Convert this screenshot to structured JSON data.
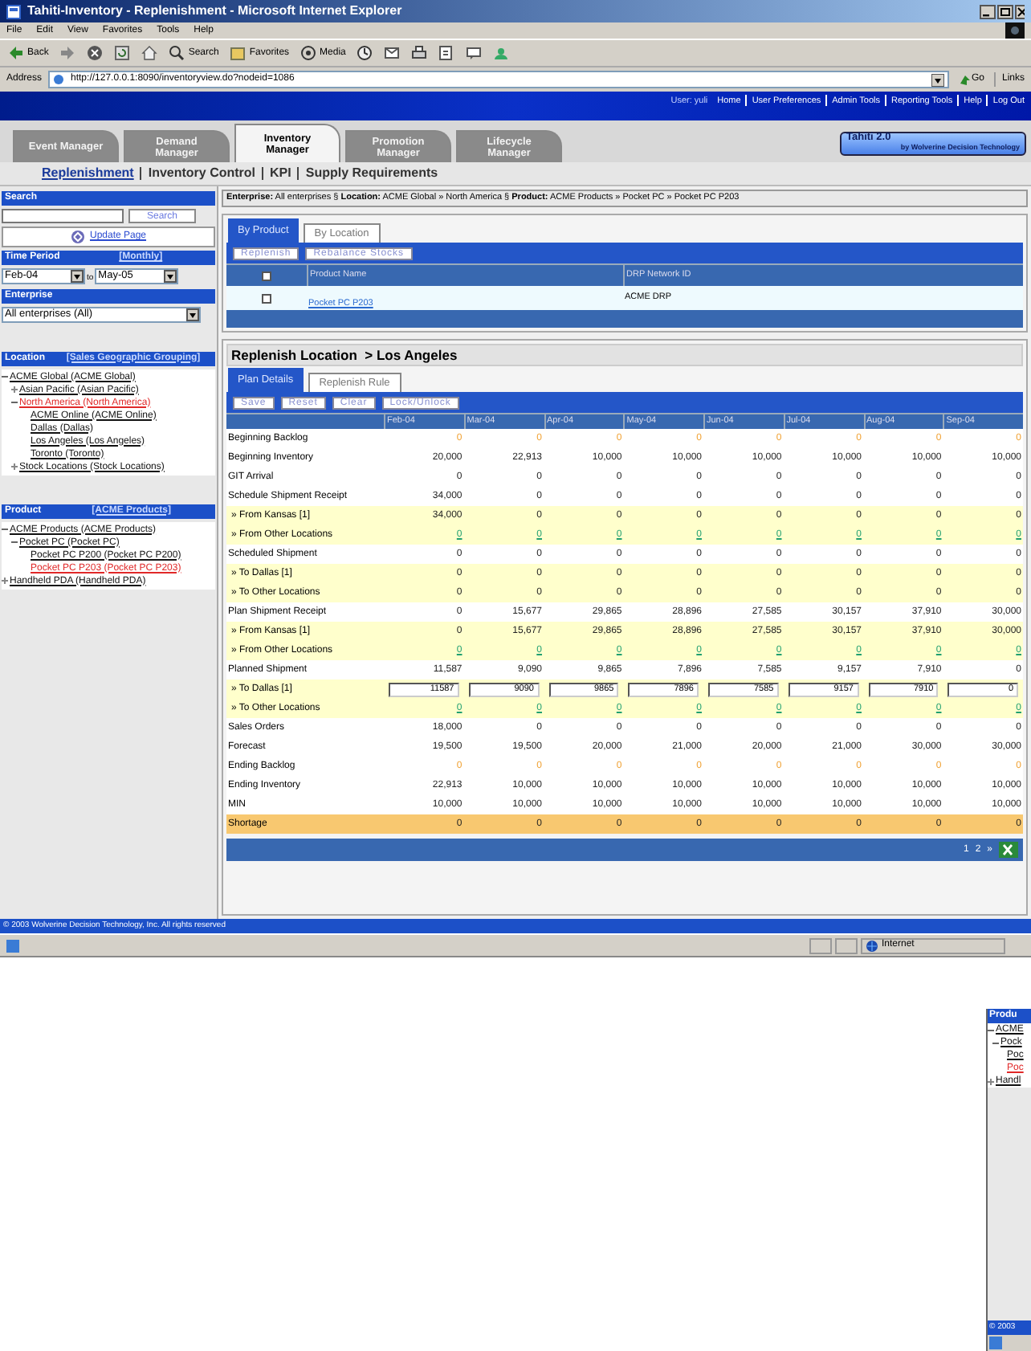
{
  "window": {
    "title": "Tahiti-Inventory - Replenishment - Microsoft Internet Explorer"
  },
  "menu": [
    "File",
    "Edit",
    "View",
    "Favorites",
    "Tools",
    "Help"
  ],
  "toolbar": [
    {
      "kind": "back",
      "label": "Back"
    },
    {
      "kind": "forward"
    },
    {
      "kind": "stop"
    },
    {
      "kind": "refresh"
    },
    {
      "kind": "home"
    },
    {
      "kind": "search",
      "label": "Search"
    },
    {
      "kind": "favorites",
      "label": "Favorites"
    },
    {
      "kind": "media",
      "label": "Media"
    },
    {
      "kind": "history"
    },
    {
      "kind": "mail"
    },
    {
      "kind": "print"
    },
    {
      "kind": "edit"
    },
    {
      "kind": "discuss"
    },
    {
      "kind": "messenger"
    }
  ],
  "address": {
    "label": "Address",
    "url": "http://127.0.0.1:8090/inventoryview.do?nodeid=1086",
    "go": "Go",
    "links": "Links"
  },
  "header": {
    "user": "User: yuli",
    "links": [
      "Home",
      "User Preferences",
      "Admin Tools",
      "Reporting Tools",
      "Help",
      "Log Out"
    ]
  },
  "modules": [
    {
      "label": "Event Manager",
      "selected": false
    },
    {
      "label": "Demand Manager",
      "selected": false
    },
    {
      "label": "Inventory Manager",
      "selected": true
    },
    {
      "label": "Promotion Manager",
      "selected": false
    },
    {
      "label": "Lifecycle Manager",
      "selected": false
    }
  ],
  "logo": {
    "name": "Tahiti 2.0",
    "tagline": "by Wolverine Decision Technology"
  },
  "subnav": [
    {
      "label": "Replenishment",
      "selected": true
    },
    {
      "label": "Inventory Control",
      "selected": false
    },
    {
      "label": "KPI",
      "selected": false
    },
    {
      "label": "Supply Requirements",
      "selected": false
    }
  ],
  "sidebar": {
    "search": {
      "title": "Search",
      "button": "Search"
    },
    "update": "Update Page",
    "time_period": {
      "title": "Time Period",
      "mode": "[Monthly]",
      "from": "Feb-04",
      "to_label": "to",
      "to": "May-05"
    },
    "enterprise": {
      "title": "Enterprise",
      "value": "All enterprises (All)"
    },
    "location": {
      "title": "Location",
      "grouping": "[Sales Geographic Grouping]",
      "tree": [
        {
          "label": "ACME Global (ACME Global)",
          "expanded": true,
          "selected": false,
          "children": [
            {
              "label": "Asian Pacific (Asian Pacific)",
              "expanded": false,
              "selected": false
            },
            {
              "label": "North America (North America)",
              "expanded": true,
              "selected": true,
              "children": [
                {
                  "label": "ACME Online (ACME Online)",
                  "selected": false
                },
                {
                  "label": "Dallas (Dallas)",
                  "selected": false
                },
                {
                  "label": "Los Angeles (Los Angeles)",
                  "selected": false
                },
                {
                  "label": "Toronto (Toronto)",
                  "selected": false
                }
              ]
            },
            {
              "label": "Stock Locations (Stock Locations)",
              "expanded": false,
              "selected": false
            }
          ]
        }
      ]
    },
    "product": {
      "title": "Product",
      "grouping": "[ACME Products]",
      "tree": [
        {
          "label": "ACME Products (ACME Products)",
          "expanded": true,
          "selected": false,
          "children": [
            {
              "label": "Pocket PC (Pocket PC)",
              "expanded": true,
              "selected": false,
              "children": [
                {
                  "label": "Pocket PC P200 (Pocket PC P200)",
                  "selected": false
                },
                {
                  "label": "Pocket PC P203 (Pocket PC P203)",
                  "selected": true
                }
              ]
            }
          ]
        },
        {
          "label": "Handheld PDA (Handheld PDA)",
          "expanded": false,
          "selected": false
        }
      ]
    }
  },
  "breadcrumb": {
    "separator": "§",
    "parts": [
      {
        "label": "Enterprise:",
        "value": "All enterprises"
      },
      {
        "label": "Location:",
        "value": "ACME Global » North America"
      },
      {
        "label": "Product:",
        "value": "ACME Products » Pocket PC » Pocket PC P203"
      }
    ]
  },
  "product_panel": {
    "tabs": [
      {
        "label": "By Product",
        "selected": true
      },
      {
        "label": "By Location",
        "selected": false
      }
    ],
    "buttons": [
      "Replenish",
      "Rebalance Stocks"
    ],
    "columns": [
      "Product Name",
      "DRP Network ID"
    ],
    "header_checked": false,
    "rows": [
      {
        "checked": false,
        "product": "Pocket PC P203",
        "network": "ACME DRP"
      }
    ]
  },
  "plan_panel": {
    "title": "Replenish Location  > Los Angeles",
    "tabs": [
      {
        "label": "Plan Details",
        "selected": true
      },
      {
        "label": "Replenish Rule",
        "selected": false
      }
    ],
    "buttons": [
      "Save",
      "Reset",
      "Clear",
      "Lock/Unlock"
    ],
    "columns": [
      "Feb-04",
      "Mar-04",
      "Apr-04",
      "May-04",
      "Jun-04",
      "Jul-04",
      "Aug-04",
      "Sep-04"
    ],
    "rows": [
      {
        "label": "Beginning Backlog",
        "kind": "backlog",
        "values": [
          "0",
          "0",
          "0",
          "0",
          "0",
          "0",
          "0",
          "0"
        ]
      },
      {
        "label": "Beginning Inventory",
        "kind": "plain",
        "values": [
          "20,000",
          "22,913",
          "10,000",
          "10,000",
          "10,000",
          "10,000",
          "10,000",
          "10,000"
        ]
      },
      {
        "label": "GIT Arrival",
        "kind": "plain",
        "values": [
          "0",
          "0",
          "0",
          "0",
          "0",
          "0",
          "0",
          "0"
        ]
      },
      {
        "label": "Schedule Shipment Receipt",
        "kind": "plain",
        "values": [
          "34,000",
          "0",
          "0",
          "0",
          "0",
          "0",
          "0",
          "0"
        ]
      },
      {
        "label": "» From Kansas [1]",
        "kind": "detail",
        "values": [
          "34,000",
          "0",
          "0",
          "0",
          "0",
          "0",
          "0",
          "0"
        ]
      },
      {
        "label": "» From Other Locations",
        "kind": "detail_link",
        "values": [
          "0",
          "0",
          "0",
          "0",
          "0",
          "0",
          "0",
          "0"
        ]
      },
      {
        "label": "Scheduled Shipment",
        "kind": "plain",
        "values": [
          "0",
          "0",
          "0",
          "0",
          "0",
          "0",
          "0",
          "0"
        ]
      },
      {
        "label": "» To Dallas [1]",
        "kind": "detail",
        "values": [
          "0",
          "0",
          "0",
          "0",
          "0",
          "0",
          "0",
          "0"
        ]
      },
      {
        "label": "» To Other Locations",
        "kind": "detail",
        "values": [
          "0",
          "0",
          "0",
          "0",
          "0",
          "0",
          "0",
          "0"
        ]
      },
      {
        "label": "Plan Shipment Receipt",
        "kind": "plain",
        "values": [
          "0",
          "15,677",
          "29,865",
          "28,896",
          "27,585",
          "30,157",
          "37,910",
          "30,000"
        ]
      },
      {
        "label": "» From Kansas [1]",
        "kind": "detail",
        "values": [
          "0",
          "15,677",
          "29,865",
          "28,896",
          "27,585",
          "30,157",
          "37,910",
          "30,000"
        ]
      },
      {
        "label": "» From Other Locations",
        "kind": "detail_link",
        "values": [
          "0",
          "0",
          "0",
          "0",
          "0",
          "0",
          "0",
          "0"
        ]
      },
      {
        "label": "Planned Shipment",
        "kind": "plain",
        "values": [
          "11,587",
          "9,090",
          "9,865",
          "7,896",
          "7,585",
          "9,157",
          "7,910",
          "0"
        ]
      },
      {
        "label": "» To Dallas [1]",
        "kind": "detail_input",
        "values": [
          "11587",
          "9090",
          "9865",
          "7896",
          "7585",
          "9157",
          "7910",
          "0"
        ]
      },
      {
        "label": "» To Other Locations",
        "kind": "detail_link",
        "values": [
          "0",
          "0",
          "0",
          "0",
          "0",
          "0",
          "0",
          "0"
        ]
      },
      {
        "label": "Sales Orders",
        "kind": "plain",
        "values": [
          "18,000",
          "0",
          "0",
          "0",
          "0",
          "0",
          "0",
          "0"
        ]
      },
      {
        "label": "Forecast",
        "kind": "plain",
        "values": [
          "19,500",
          "19,500",
          "20,000",
          "21,000",
          "20,000",
          "21,000",
          "30,000",
          "30,000"
        ]
      },
      {
        "label": "Ending Backlog",
        "kind": "backlog",
        "values": [
          "0",
          "0",
          "0",
          "0",
          "0",
          "0",
          "0",
          "0"
        ]
      },
      {
        "label": "Ending Inventory",
        "kind": "plain",
        "values": [
          "22,913",
          "10,000",
          "10,000",
          "10,000",
          "10,000",
          "10,000",
          "10,000",
          "10,000"
        ]
      },
      {
        "label": "MIN",
        "kind": "plain",
        "values": [
          "10,000",
          "10,000",
          "10,000",
          "10,000",
          "10,000",
          "10,000",
          "10,000",
          "10,000"
        ]
      },
      {
        "label": "Shortage",
        "kind": "shortage",
        "values": [
          "0",
          "0",
          "0",
          "0",
          "0",
          "0",
          "0",
          "0"
        ]
      }
    ],
    "pages": [
      "1",
      "2",
      "»"
    ]
  },
  "footer": "© 2003 Wolverine Decision Technology, Inc. All rights reserved",
  "status_bar": {
    "zone": "Internet"
  },
  "background_window": {
    "header": "Produ",
    "tree": [
      {
        "label": "ACME",
        "expanded": true,
        "selected": false,
        "children": [
          {
            "label": "Pock",
            "expanded": true,
            "selected": false,
            "children": [
              {
                "label": "Poc",
                "selected": false
              },
              {
                "label": "Poc",
                "selected": true
              }
            ]
          }
        ]
      },
      {
        "label": "Handl",
        "expanded": false,
        "selected": false
      }
    ],
    "footer": "© 2003"
  }
}
